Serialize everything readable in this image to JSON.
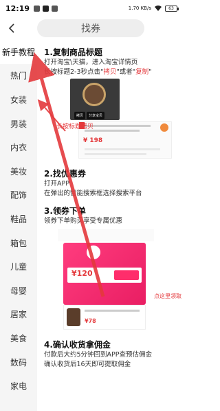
{
  "status_bar": {
    "time": "12:19",
    "network_speed": "1.70 KB/s",
    "battery": "63"
  },
  "header": {
    "back_label": "<",
    "title": "找券"
  },
  "sidebar": {
    "items": [
      {
        "label": "新手教程"
      },
      {
        "label": "热门"
      },
      {
        "label": "女装"
      },
      {
        "label": "男装"
      },
      {
        "label": "内衣"
      },
      {
        "label": "美妆"
      },
      {
        "label": "配饰"
      },
      {
        "label": "鞋品"
      },
      {
        "label": "箱包"
      },
      {
        "label": "儿童"
      },
      {
        "label": "母婴"
      },
      {
        "label": "居家"
      },
      {
        "label": "美食"
      },
      {
        "label": "数码"
      },
      {
        "label": "家电"
      }
    ]
  },
  "steps": {
    "s1": {
      "title": "1.复制商品标题",
      "line1": "打开淘宝\\天猫，进入淘宝详情页",
      "line2_pre": "长按标题2-3秒点击\"",
      "line2_copy1": "拷贝",
      "line2_mid": "\"或者\"",
      "line2_copy2": "复制",
      "line2_post": "\""
    },
    "s2": {
      "title": "2.找优惠券",
      "line1": "打开APP",
      "line2": "在弹出的智能搜索框选择搜索平台"
    },
    "s3": {
      "title": "3.领券下单",
      "line1": "领券下单购买享受专属优惠"
    },
    "s4": {
      "title": "4.确认收货拿佣金",
      "line1": "付款后大约5分钟回到APP查预估佣金",
      "line2": "确认收货后16天即可提取佣金"
    }
  },
  "illustrations": {
    "copy_chip": "拷贝",
    "share_chip": "分享宝贝",
    "longpress_label": "长按标题拷贝",
    "price_1": "¥ 198",
    "coupon_amount": "¥120",
    "price_2": "¥78",
    "claim_label": "点这里领取"
  },
  "colors": {
    "accent_red": "#e4393c",
    "coupon_pink": "#ff3c7e"
  }
}
